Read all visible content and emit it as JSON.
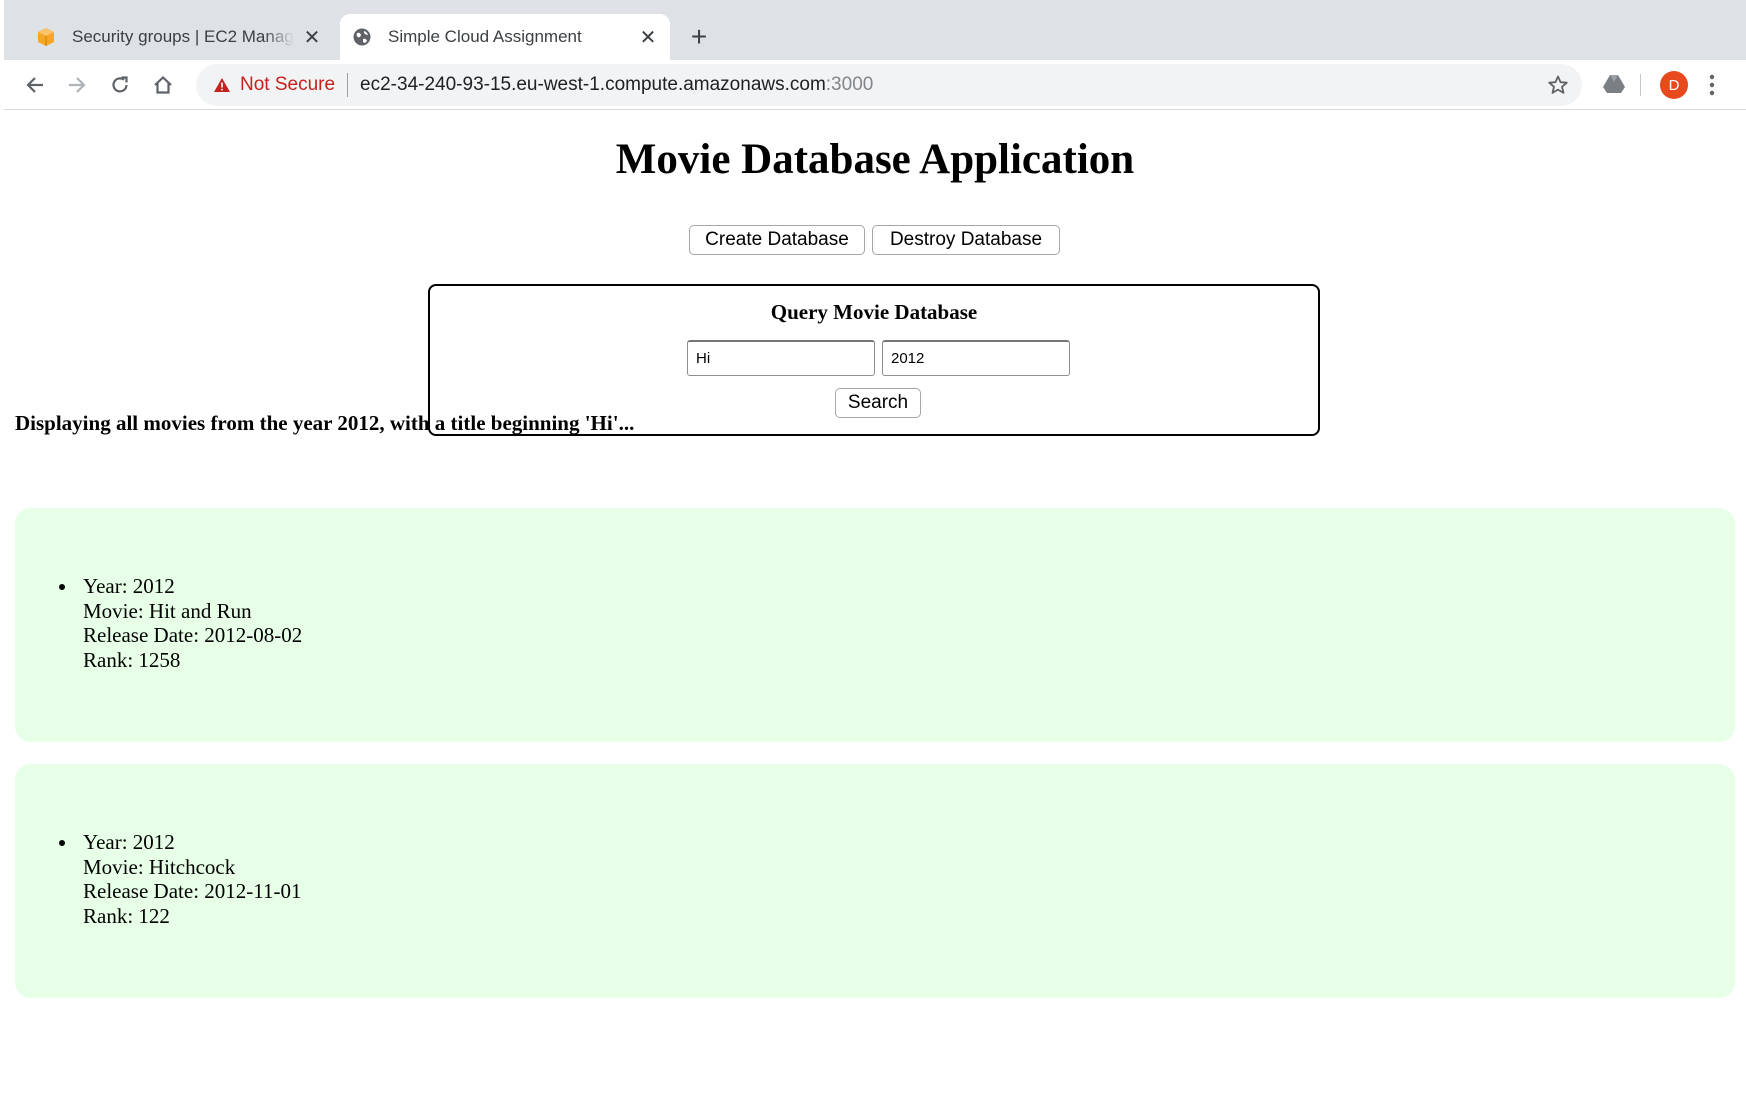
{
  "browser": {
    "tabs": [
      {
        "title": "Security groups | EC2 Management Console",
        "icon": "aws-box-icon",
        "active": false
      },
      {
        "title": "Simple Cloud Assignment",
        "icon": "globe-icon",
        "active": true
      }
    ],
    "new_tab_label": "+",
    "address_bar": {
      "security_label": "Not Secure",
      "host": "ec2-34-240-93-15.eu-west-1.compute.amazonaws.com",
      "port": ":3000"
    },
    "profile_initial": "D",
    "colors": {
      "tab_strip": "#dee1e6",
      "not_secure": "#c5221f",
      "avatar": "#e8491d"
    }
  },
  "page": {
    "title": "Movie Database Application",
    "create_button": "Create Database",
    "destroy_button": "Destroy Database",
    "query": {
      "heading": "Query Movie Database",
      "title_value": "Hi",
      "year_value": "2012",
      "search_button": "Search"
    },
    "result_summary": "Displaying all movies from the year 2012, with a title beginning 'Hi'...",
    "results": [
      {
        "year": "Year: 2012",
        "movie": "Movie: Hit and Run",
        "release": "Release Date: 2012-08-02",
        "rank": "Rank: 1258"
      },
      {
        "year": "Year: 2012",
        "movie": "Movie: Hitchcock",
        "release": "Release Date: 2012-11-01",
        "rank": "Rank: 122"
      }
    ],
    "colors": {
      "result_card_bg": "#e6ffe6"
    }
  }
}
